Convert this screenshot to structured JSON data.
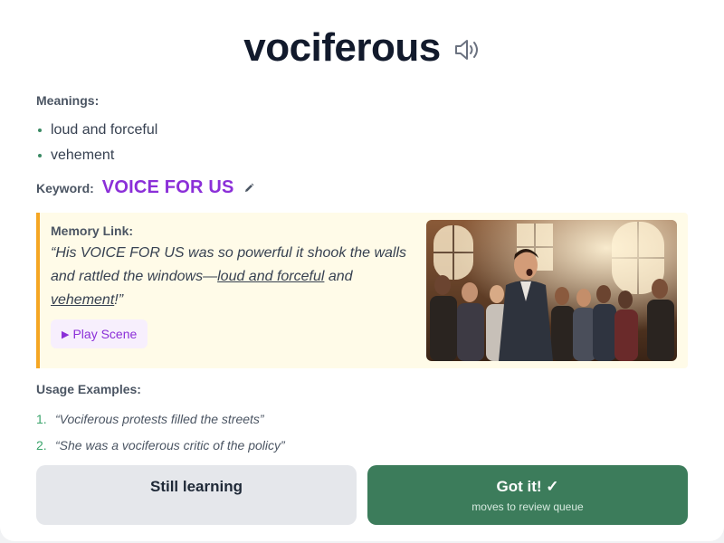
{
  "word": "vociferous",
  "meanings_label": "Meanings:",
  "meanings": [
    "loud and forceful",
    "vehement"
  ],
  "keyword_label": "Keyword:",
  "keyword": "VOICE FOR US",
  "memory": {
    "label": "Memory Link:",
    "quote_part1": "“His VOICE FOR US was so powerful it shook the walls and rattled the windows—",
    "quote_u1": "loud and forceful",
    "quote_part2": " and ",
    "quote_u2": "vehement",
    "quote_part3": "!”",
    "play_label": "Play Scene"
  },
  "usage_label": "Usage Examples:",
  "examples": [
    {
      "num": "1.",
      "text": "“Vociferous protests filled the streets”"
    },
    {
      "num": "2.",
      "text": "“She was a vociferous critic of the policy”"
    }
  ],
  "buttons": {
    "still_learning": "Still learning",
    "got_it": "Got it! ✓",
    "got_it_sub": "moves to review queue"
  },
  "icons": {
    "speaker": "speaker-icon",
    "pencil": "pencil-icon",
    "play": "play-icon"
  },
  "colors": {
    "keyword": "#8b2fd8",
    "memory_bg": "#fffbe8",
    "memory_border": "#f5a623",
    "got_it_bg": "#3c7c5b",
    "still_learning_bg": "#e5e7eb",
    "bullet": "#3b8a64",
    "example_number": "#3aa46b"
  }
}
